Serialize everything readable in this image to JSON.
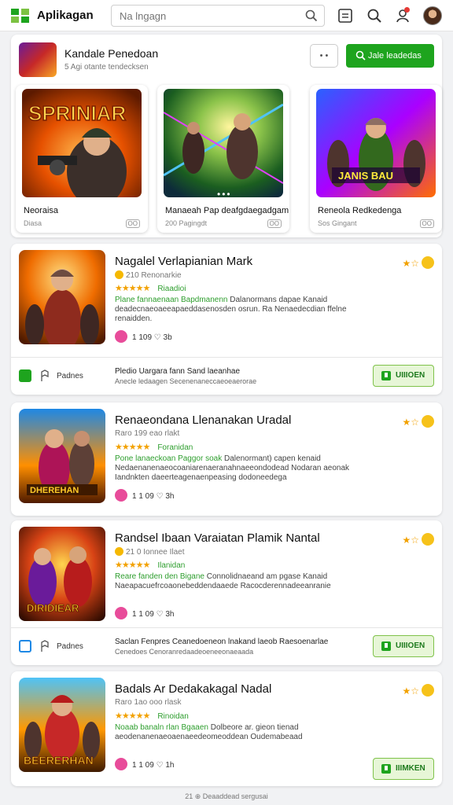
{
  "header": {
    "app_name": "Aplikagan",
    "search_placeholder": "Na lngagn",
    "search_value": "Na lngagn"
  },
  "featured": {
    "title": "Kandale Penedoan",
    "subtitle": "5 Agi otante tendecksen",
    "more_label": "• •",
    "action_label": "Jale leadedas",
    "cards": [
      {
        "title": "Neoraisa",
        "subtitle": "Diasa",
        "badge": "OO",
        "art_text": "SPRINIAR"
      },
      {
        "title": "Manaeah Pap deafgdaegadgam",
        "subtitle": "200 Pagingdt",
        "badge": "OO",
        "dots": "•••"
      },
      {
        "title": "Reneola Redkedenga",
        "subtitle": "Sos Gingant",
        "badge": "OO",
        "art_text": "JANIS BAU"
      }
    ]
  },
  "listings": [
    {
      "name": "Nagalel Verlapianian Mark",
      "meta": "210 Renonarkie",
      "stars": "★★★★★",
      "tag": "Riaadioi",
      "desc_lead": "Plane fannaenaan Bapdmanenn",
      "desc": "Dalanormans dapae Kanaid deadecnaeoaeeapaeddasenosden osrun. Ra Nenaedecdian ffelne renaidden.",
      "stat": "1 109 ♡ 3b",
      "rate": "★☆",
      "check_label": "Padnes",
      "notice_1": "Pledio Uargara fann Sand laeanhae",
      "notice_2": "Anecle ledaagen Secenenaneccaeoeaerorae",
      "button": "UIIIOEN"
    },
    {
      "name": "Renaeondana Llenanakan Uradal",
      "meta": "Raro 199 eao rlakt",
      "stars": "★★★★★",
      "tag": "Foranidan",
      "desc_lead": "Pone lanaeckoan Paggor soak",
      "desc": "Dalenormant) capen kenaid Nedaenanenaeocoaniarenaeranahnaeeondodead Nodaran aeonak Iandnkten daeerteagenaenpeasing dodoneedega",
      "stat": "1 1 09 ♡ 3h",
      "rate": "★☆"
    },
    {
      "name": "Randsel Ibaan Varaiatan Plamik Nantal",
      "meta": "21 0 Ionnee Ilaet",
      "stars": "★★★★★",
      "tag": "Ilanidan",
      "desc_lead": "Reare fanden den Bigane",
      "desc": "Connolidnaeand am pgase Kanaid Naeapacuefrcoaonebeddendaaede Racocderennadeeanranie",
      "stat": "1 1 09 ♡ 3h",
      "rate": "★☆",
      "check_label": "Padnes",
      "notice_1": "Saclan Fenpres Ceanedoeneon lnakand laeob Raesoenarlae",
      "notice_2": "Cenedoes Cenoranredaadeoeneeonaeaada",
      "button": "UIIIOEN"
    },
    {
      "name": "Badals Ar Dedakakagal Nadal",
      "meta": "Raro 1ao ooo rlask",
      "stars": "★★★★★",
      "tag": "Rinoidan",
      "desc_lead": "Noaab banaln rlan Bgaaen",
      "desc": "Dolbeore ar. gieon tienad aeodenanenaeoaenaeedeomeoddean Oudemabeaad",
      "stat": "1 1 09 ♡ 1h",
      "rate": "★☆",
      "button": "IIIMKEN"
    }
  ],
  "footer": "21 ⊕ Deaaddead sergusai"
}
